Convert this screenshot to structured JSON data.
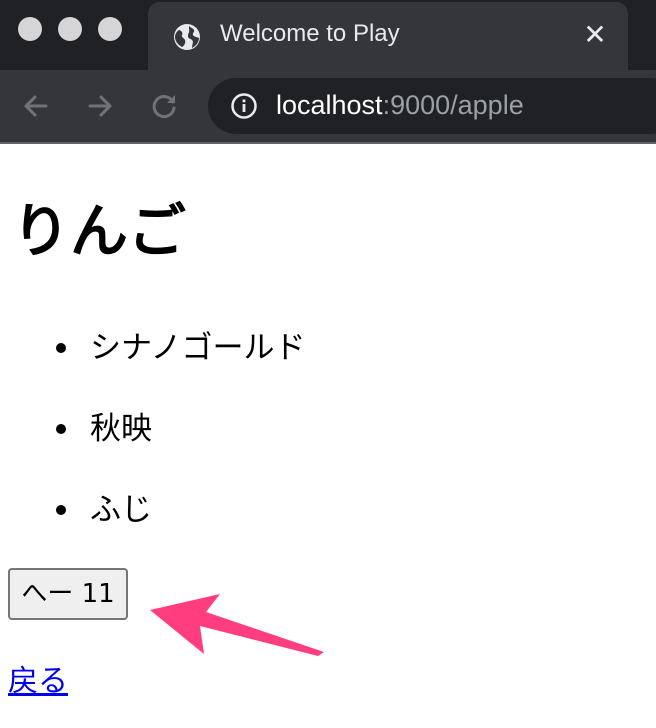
{
  "browser": {
    "tab": {
      "title": "Welcome to Play",
      "close_glyph": "✕",
      "icon": "globe-icon"
    },
    "url": {
      "host": "localhost",
      "rest": ":9000/apple"
    },
    "icons": [
      "back-arrow-icon",
      "forward-arrow-icon",
      "reload-icon",
      "info-icon"
    ],
    "traffic_light_color": "#d5d5d7"
  },
  "page": {
    "heading": "りんご",
    "apples": [
      "シナノゴールド",
      "秋映",
      "ふじ"
    ],
    "button_label": "へー 11",
    "back_link": "戻る",
    "link_color": "#0000ee"
  },
  "annotation": {
    "arrow_color": "#ff3d7f",
    "points_to": "count-button"
  }
}
